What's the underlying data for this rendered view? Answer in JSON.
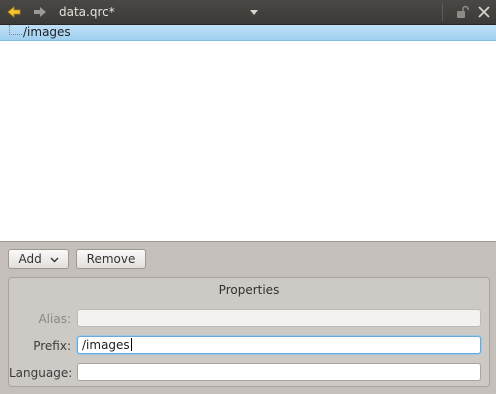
{
  "titlebar": {
    "filename": "data.qrc*",
    "icons": [
      "left-arrow-icon",
      "right-arrow-icon",
      "dropdown-arrow-icon",
      "lock-icon",
      "close-icon"
    ]
  },
  "tree": {
    "items": [
      {
        "label": "/images",
        "selected": true
      }
    ]
  },
  "actions": {
    "add_label": "Add",
    "remove_label": "Remove"
  },
  "properties": {
    "title": "Properties",
    "alias_label": "Alias:",
    "alias_value": "",
    "prefix_label": "Prefix:",
    "prefix_value": "/images",
    "language_label": "Language:",
    "language_value": ""
  },
  "colors": {
    "selection": "#a9d6f3",
    "titlebar": "#3f3e3b",
    "panel": "#c4bfba",
    "nav_arrow": "#f0c33c"
  }
}
